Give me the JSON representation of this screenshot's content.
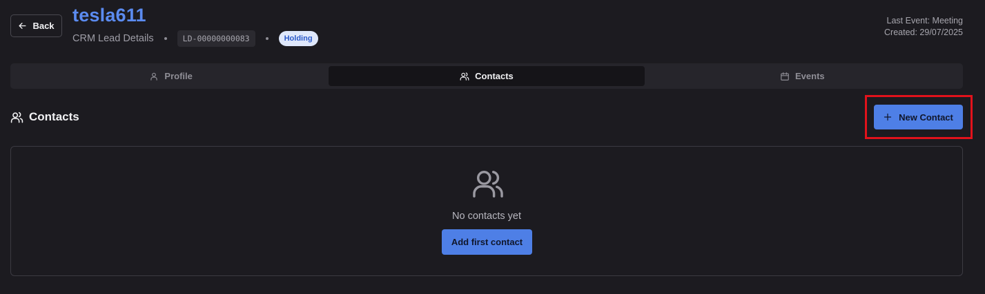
{
  "header": {
    "back_label": "Back",
    "title": "tesla611",
    "subtitle": "CRM Lead Details",
    "lead_id": "LD-00000000083",
    "status": "Holding",
    "last_event": "Last Event: Meeting",
    "created": "Created: 29/07/2025"
  },
  "tabs": [
    {
      "label": "Profile",
      "icon": "user-icon",
      "active": false
    },
    {
      "label": "Contacts",
      "icon": "users-icon",
      "active": true
    },
    {
      "label": "Events",
      "icon": "calendar-icon",
      "active": false
    }
  ],
  "section": {
    "title": "Contacts",
    "new_button_label": "New Contact"
  },
  "empty_state": {
    "message": "No contacts yet",
    "button_label": "Add first contact"
  },
  "colors": {
    "background": "#1c1b20",
    "accent": "#4e7fe6",
    "title": "#5b8bf0",
    "highlight": "#e2121b"
  }
}
